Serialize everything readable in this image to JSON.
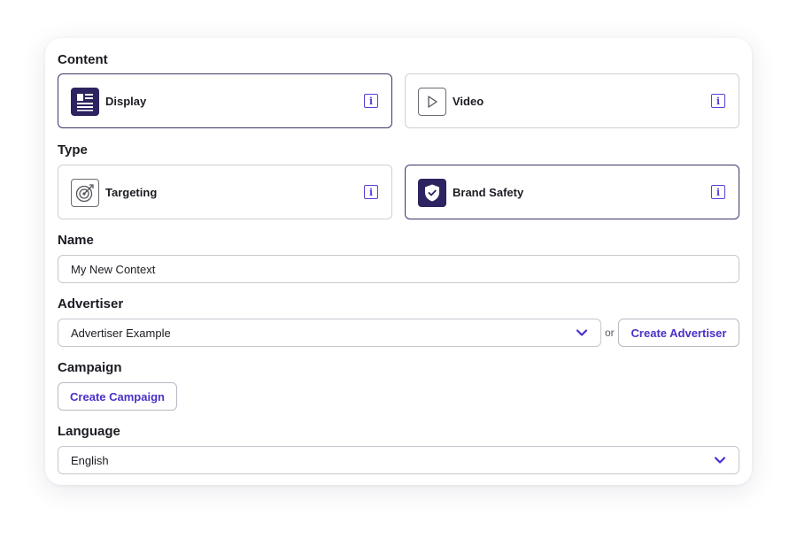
{
  "content": {
    "label": "Content",
    "options": [
      {
        "label": "Display",
        "icon": "display-icon",
        "selected": true
      },
      {
        "label": "Video",
        "icon": "play-icon",
        "selected": false
      }
    ]
  },
  "type": {
    "label": "Type",
    "options": [
      {
        "label": "Targeting",
        "icon": "target-icon",
        "selected": false
      },
      {
        "label": "Brand Safety",
        "icon": "shield-icon",
        "selected": true
      }
    ]
  },
  "info_glyph": "i",
  "name": {
    "label": "Name",
    "value": "My New Context"
  },
  "advertiser": {
    "label": "Advertiser",
    "value": "Advertiser Example",
    "or_text": "or",
    "create_label": "Create Advertiser"
  },
  "campaign": {
    "label": "Campaign",
    "create_label": "Create Campaign"
  },
  "language": {
    "label": "Language",
    "value": "English"
  },
  "colors": {
    "accent": "#5b3fd9",
    "selected_border": "#3a3566",
    "icon_fill": "#2c2360"
  }
}
